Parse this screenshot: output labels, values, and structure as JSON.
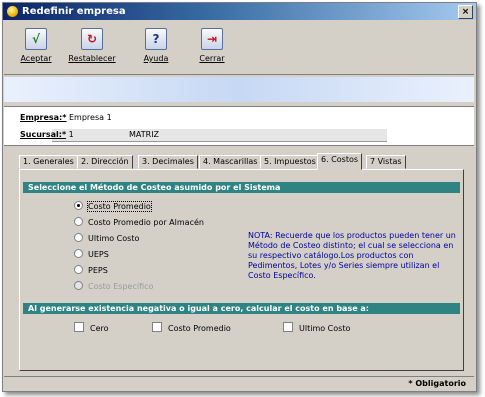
{
  "window": {
    "title": "Redefinir empresa",
    "close_glyph": "×"
  },
  "toolbar": {
    "buttons": [
      {
        "label": "Aceptar",
        "icon": "checkmark-icon",
        "glyph": "√"
      },
      {
        "label": "Restablecer",
        "icon": "refresh-icon",
        "glyph": "↻"
      },
      {
        "label": "Ayuda",
        "icon": "help-icon",
        "glyph": "?"
      },
      {
        "label": "Cerrar",
        "icon": "exit-icon",
        "glyph": "⇥"
      }
    ]
  },
  "info": {
    "empresa_label": "Empresa:*",
    "empresa_value": "Empresa 1",
    "sucursal_label": "Sucursal:*",
    "sucursal_code": "1",
    "sucursal_name": "MATRIZ"
  },
  "tabs": [
    {
      "label": "1. Generales"
    },
    {
      "label": "2. Dirección"
    },
    {
      "label": "3. Decimales"
    },
    {
      "label": "4. Mascarillas"
    },
    {
      "label": "5. Impuestos"
    },
    {
      "label": "6. Costos"
    },
    {
      "label": "7 Vistas"
    }
  ],
  "active_tab": "6. Costos",
  "costos": {
    "method_header": "Seleccione el Método de Costeo asumido por el Sistema",
    "options": [
      {
        "label": "Costo Promedio",
        "selected": true,
        "disabled": false
      },
      {
        "label": "Costo Promedio por Almacén",
        "selected": false,
        "disabled": false
      },
      {
        "label": "Ultimo Costo",
        "selected": false,
        "disabled": false
      },
      {
        "label": "UEPS",
        "selected": false,
        "disabled": false
      },
      {
        "label": "PEPS",
        "selected": false,
        "disabled": false
      },
      {
        "label": "Costo Específico",
        "selected": false,
        "disabled": true
      }
    ],
    "note": "NOTA: Recuerde que los productos pueden tener un Método de Costeo distinto; el cual se selecciona en su respectivo catálogo.Los productos con Pedimentos, Lotes y/o Series siempre utilizan el Costo Específico.",
    "negative_header": "Al generarse existencia negativa o igual a cero, calcular el costo en base a:",
    "checkboxes": [
      {
        "label": "Cero",
        "checked": false
      },
      {
        "label": "Costo Promedio",
        "checked": false
      },
      {
        "label": "Ultimo Costo",
        "checked": false
      }
    ]
  },
  "status": {
    "required_note": "* Obligatorio"
  },
  "colors": {
    "title_bar": "#0a246a",
    "section_header": "#2f8383",
    "note_text": "#0000a0",
    "window_bg": "#d4d0c8"
  }
}
